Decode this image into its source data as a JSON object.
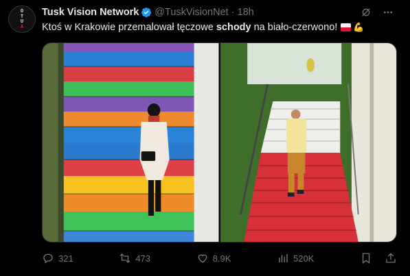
{
  "author": {
    "name": "Tusk Vision Network",
    "handle": "@TuskVisionNet",
    "time": "18h",
    "avatar_text": [
      "O",
      "T",
      "U",
      "A"
    ]
  },
  "post": {
    "text_before": "Ktoś w Krakowie przemalował tęczowe",
    "text_bold": "schody",
    "text_after": "na biało-czerwono!",
    "emoji_arm": "💪"
  },
  "stats": {
    "replies": "321",
    "reposts": "473",
    "likes": "8.9K",
    "views": "520K"
  },
  "colors": {
    "background": "#000000",
    "text": "#e7e9ea",
    "muted": "#71767b",
    "verified": "#1d9bf0",
    "flag_white": "#f2f2f2",
    "flag_red": "#dc143c"
  },
  "icons": [
    "verified-badge-icon",
    "grok-icon",
    "more-icon",
    "reply-icon",
    "repost-icon",
    "like-icon",
    "views-icon",
    "bookmark-icon",
    "share-icon"
  ]
}
